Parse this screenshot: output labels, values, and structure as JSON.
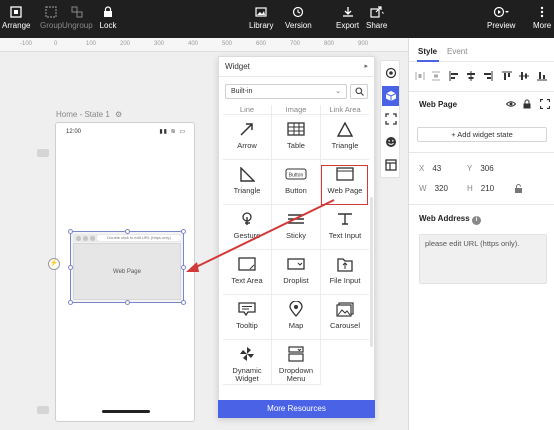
{
  "toolbar": {
    "left": [
      {
        "label": "Arrange",
        "icon": "arrange-icon",
        "enabled": true
      },
      {
        "label": "Group",
        "icon": "group-icon",
        "enabled": false
      },
      {
        "label": "Ungroup",
        "icon": "ungroup-icon",
        "enabled": false
      },
      {
        "label": "Lock",
        "icon": "lock-icon",
        "enabled": true
      }
    ],
    "center": [
      {
        "label": "Library",
        "icon": "library-icon"
      },
      {
        "label": "Version",
        "icon": "history-icon"
      },
      {
        "label": "Export",
        "icon": "download-icon"
      },
      {
        "label": "Share",
        "icon": "share-icon"
      }
    ],
    "right": [
      {
        "label": "Preview",
        "icon": "play-icon"
      },
      {
        "label": "More",
        "icon": "more-icon"
      }
    ]
  },
  "ruler": [
    "-100",
    "0",
    "100",
    "200",
    "300",
    "400",
    "500",
    "600",
    "700",
    "800",
    "900"
  ],
  "canvas": {
    "state_label": "Home - State 1",
    "phone_time": "12:00",
    "phone_signal": "▮▮ ≋ ▭",
    "widget_url_text": "Double click to edit URL (https only)",
    "widget_inner_label": "Web Page"
  },
  "widget_panel": {
    "title": "Widget",
    "select_value": "Built-in",
    "cut_row": [
      "Line",
      "Image",
      "Link Area"
    ],
    "items": [
      {
        "label": "Arrow",
        "icon": "arrow-icon"
      },
      {
        "label": "Table",
        "icon": "table-icon"
      },
      {
        "label": "Triangle",
        "icon": "triangle-icon"
      },
      {
        "label": "Triangle",
        "icon": "right-triangle-icon"
      },
      {
        "label": "Button",
        "icon": "button-icon"
      },
      {
        "label": "Web Page",
        "icon": "web-page-icon"
      },
      {
        "label": "Gesture",
        "icon": "gesture-icon"
      },
      {
        "label": "Sticky",
        "icon": "sticky-icon"
      },
      {
        "label": "Text Input",
        "icon": "text-input-icon"
      },
      {
        "label": "Text Area",
        "icon": "text-area-icon"
      },
      {
        "label": "Droplist",
        "icon": "droplist-icon"
      },
      {
        "label": "File Input",
        "icon": "file-input-icon"
      },
      {
        "label": "Tooltip",
        "icon": "tooltip-icon"
      },
      {
        "label": "Map",
        "icon": "map-icon"
      },
      {
        "label": "Carousel",
        "icon": "carousel-icon"
      },
      {
        "label": "Dynamic Widget",
        "icon": "dynamic-widget-icon"
      },
      {
        "label": "Dropdown Menu",
        "icon": "dropdown-menu-icon"
      }
    ],
    "more_button": "More Resources"
  },
  "right_panel": {
    "tabs": [
      "Style",
      "Event"
    ],
    "active_tab": "Style",
    "selected_title": "Web Page",
    "add_state": "+ Add widget state",
    "x": "43",
    "y": "306",
    "w": "320",
    "h": "210",
    "web_address_title": "Web Address",
    "web_address_placeholder": "please edit URL (https only)."
  },
  "colors": {
    "accent": "#4a63e6",
    "highlight": "#d23a3a",
    "toolbar_bg": "#1f1f1f"
  }
}
